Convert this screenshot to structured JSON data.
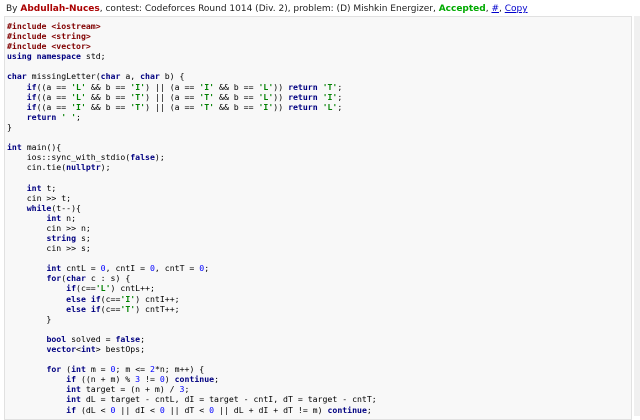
{
  "header": {
    "by": "By ",
    "author": "Abdullah-Nuces",
    "contest_text": ", contest: Codeforces Round 1014 (Div. 2), problem: (D) Mishkin Energizer, ",
    "verdict": "Accepted",
    "sep1": ", ",
    "hash_link": "#",
    "sep2": ", ",
    "copy_link": "Copy"
  },
  "code_lines": [
    "#include <iostream>",
    "#include <string>",
    "#include <vector>",
    "using namespace std;",
    "",
    "char missingLetter(char a, char b) {",
    "    if((a == 'L' && b == 'I') || (a == 'I' && b == 'L')) return 'T';",
    "    if((a == 'L' && b == 'T') || (a == 'T' && b == 'L')) return 'I';",
    "    if((a == 'I' && b == 'T') || (a == 'T' && b == 'I')) return 'L';",
    "    return ' ';",
    "}",
    "",
    "int main(){",
    "    ios::sync_with_stdio(false);",
    "    cin.tie(nullptr);",
    "",
    "    int t;",
    "    cin >> t;",
    "    while(t--){",
    "        int n;",
    "        cin >> n;",
    "        string s;",
    "        cin >> s;",
    "",
    "        int cntL = 0, cntI = 0, cntT = 0;",
    "        for(char c : s) {",
    "            if(c=='L') cntL++;",
    "            else if(c=='I') cntI++;",
    "            else if(c=='T') cntT++;",
    "        }",
    "",
    "        bool solved = false;",
    "        vector<int> bestOps;",
    "",
    "        for (int m = 0; m <= 2*n; m++) {",
    "            if ((n + m) % 3 != 0) continue;",
    "            int target = (n + m) / 3;",
    "            int dL = target - cntL, dI = target - cntI, dT = target - cntT;",
    "            if (dL < 0 || dI < 0 || dT < 0 || dL + dI + dT != m) continue;"
  ]
}
